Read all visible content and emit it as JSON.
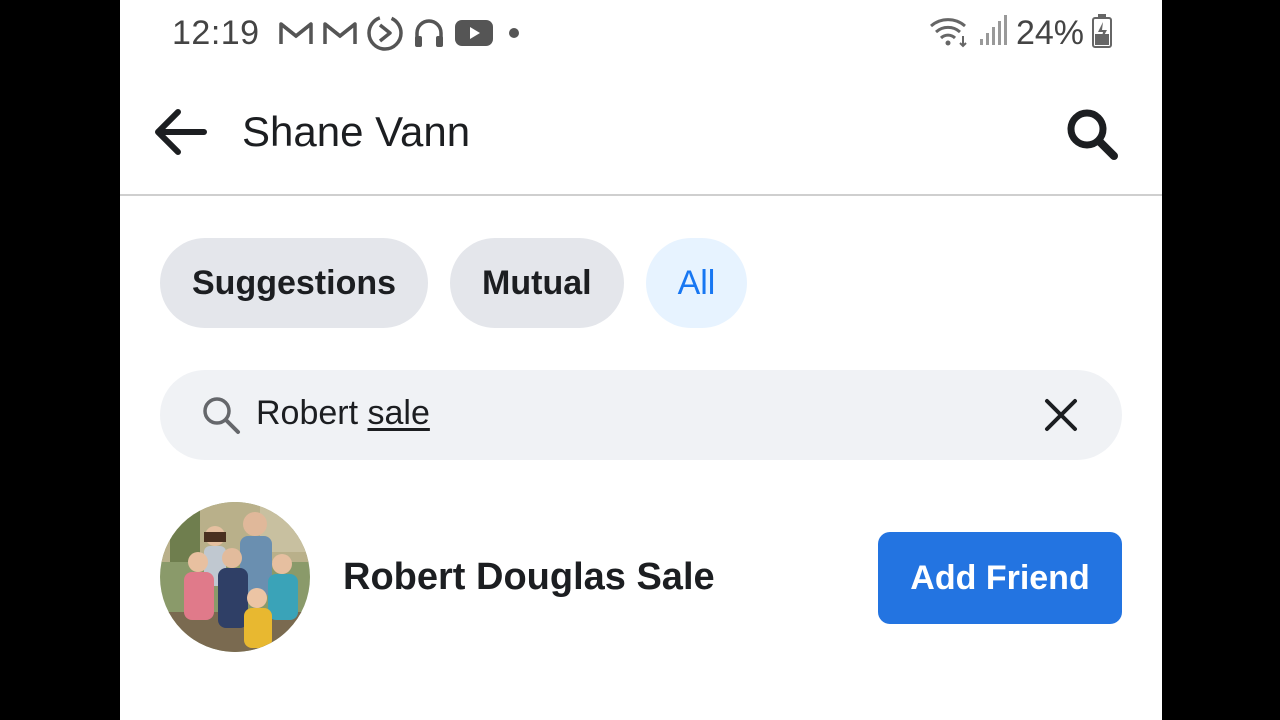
{
  "status_bar": {
    "time": "12:19",
    "icons": [
      "gmail-icon",
      "gmail-icon",
      "media-icon",
      "headphones-icon",
      "youtube-icon",
      "notification-dot-icon"
    ],
    "battery_percent": "24%",
    "right_icons": [
      "wifi-icon",
      "signal-icon",
      "battery-charging-icon"
    ]
  },
  "header": {
    "title": "Shane Vann",
    "back_icon": "back-arrow-icon",
    "search_icon": "search-icon"
  },
  "filter_chips": [
    {
      "label": "Suggestions",
      "active": false
    },
    {
      "label": "Mutual",
      "active": false
    },
    {
      "label": "All",
      "active": true
    }
  ],
  "search": {
    "value_prefix": "Robert ",
    "value_suffix": "sale",
    "clear_icon": "close-icon"
  },
  "results": [
    {
      "name": "Robert Douglas Sale",
      "action_label": "Add Friend"
    }
  ],
  "colors": {
    "accent": "#1877f2",
    "button": "#2374e1",
    "chip_bg": "#e4e6eb",
    "chip_active_bg": "#e7f3ff",
    "search_bg": "#f0f2f5"
  }
}
